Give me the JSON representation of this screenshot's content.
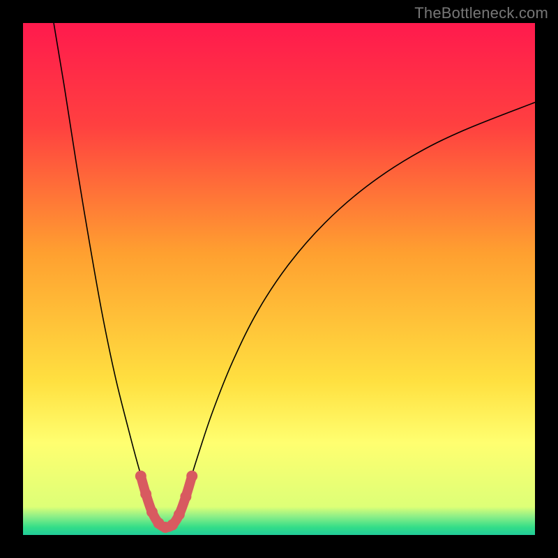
{
  "watermark": "TheBottleneck.com",
  "chart_data": {
    "type": "line",
    "title": "",
    "xlabel": "",
    "ylabel": "",
    "xlim": [
      0,
      100
    ],
    "ylim": [
      0,
      100
    ],
    "background_gradient_stops": [
      {
        "pos": 0.0,
        "color": "#ff1a4d"
      },
      {
        "pos": 0.2,
        "color": "#ff4040"
      },
      {
        "pos": 0.45,
        "color": "#ffa030"
      },
      {
        "pos": 0.7,
        "color": "#ffe040"
      },
      {
        "pos": 0.82,
        "color": "#ffff70"
      },
      {
        "pos": 0.945,
        "color": "#ddff77"
      },
      {
        "pos": 0.965,
        "color": "#88ee88"
      },
      {
        "pos": 0.985,
        "color": "#33dd88"
      },
      {
        "pos": 1.0,
        "color": "#22cc99"
      }
    ],
    "series": [
      {
        "name": "left-branch",
        "stroke": "#000000",
        "points": [
          {
            "x": 6.0,
            "y": 100.0
          },
          {
            "x": 8.0,
            "y": 88.0
          },
          {
            "x": 10.5,
            "y": 72.0
          },
          {
            "x": 13.0,
            "y": 57.0
          },
          {
            "x": 15.5,
            "y": 43.0
          },
          {
            "x": 18.0,
            "y": 31.0
          },
          {
            "x": 20.5,
            "y": 21.0
          },
          {
            "x": 22.5,
            "y": 13.5
          },
          {
            "x": 24.0,
            "y": 8.5
          }
        ]
      },
      {
        "name": "right-branch",
        "stroke": "#000000",
        "points": [
          {
            "x": 32.0,
            "y": 8.5
          },
          {
            "x": 34.0,
            "y": 15.0
          },
          {
            "x": 37.0,
            "y": 24.0
          },
          {
            "x": 41.0,
            "y": 34.0
          },
          {
            "x": 46.0,
            "y": 44.0
          },
          {
            "x": 52.0,
            "y": 53.0
          },
          {
            "x": 59.0,
            "y": 61.0
          },
          {
            "x": 67.0,
            "y": 68.0
          },
          {
            "x": 76.0,
            "y": 74.0
          },
          {
            "x": 86.0,
            "y": 79.0
          },
          {
            "x": 100.0,
            "y": 84.5
          }
        ]
      },
      {
        "name": "bottom-highlight",
        "stroke": "#d85a60",
        "points": [
          {
            "x": 23.0,
            "y": 11.5
          },
          {
            "x": 24.0,
            "y": 8.0
          },
          {
            "x": 25.2,
            "y": 4.5
          },
          {
            "x": 26.5,
            "y": 2.3
          },
          {
            "x": 27.8,
            "y": 1.5
          },
          {
            "x": 29.2,
            "y": 2.0
          },
          {
            "x": 30.5,
            "y": 4.0
          },
          {
            "x": 31.8,
            "y": 7.5
          },
          {
            "x": 33.0,
            "y": 11.5
          }
        ]
      }
    ]
  }
}
